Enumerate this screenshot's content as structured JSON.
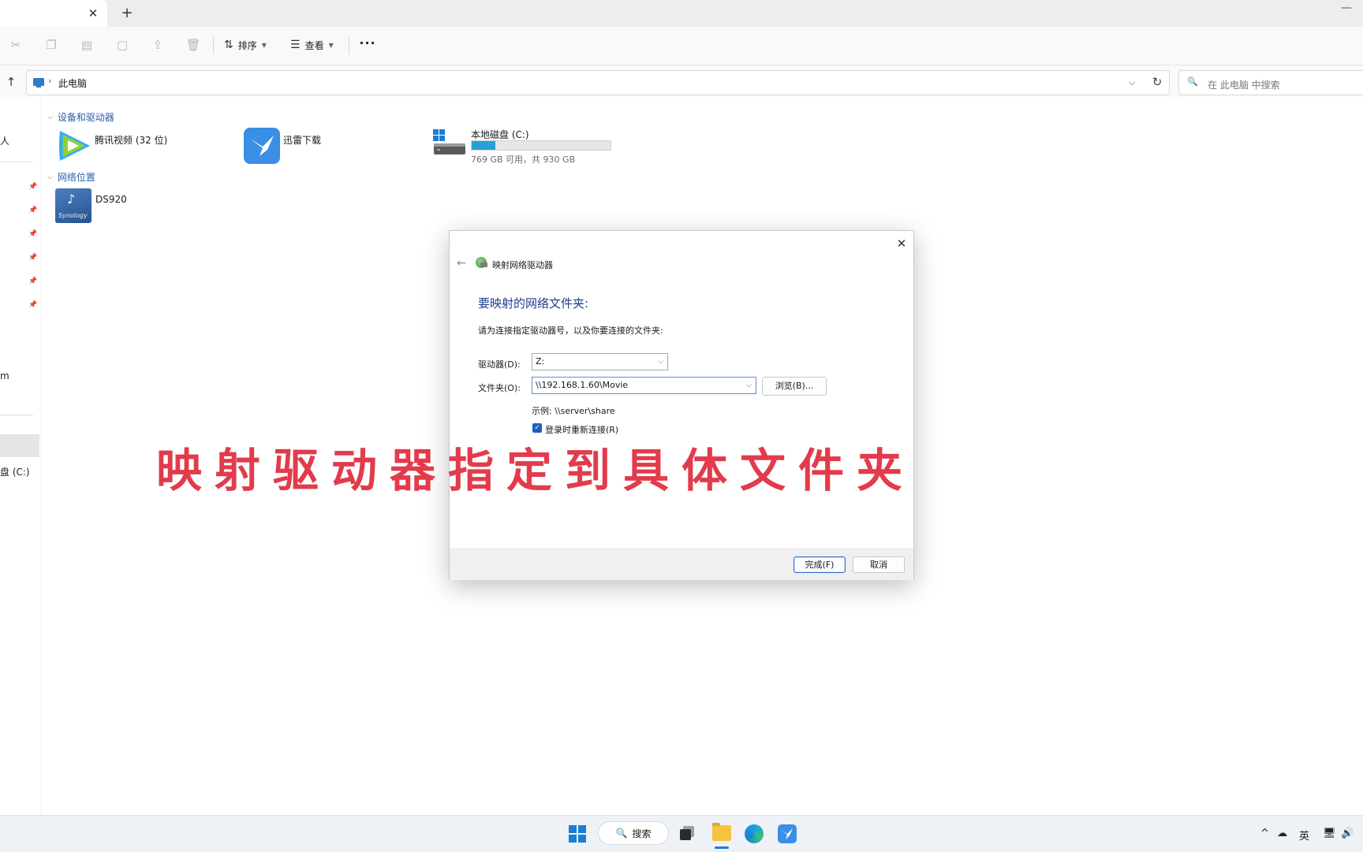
{
  "tabs": {
    "close_glyph": "✕",
    "new_glyph": "+"
  },
  "window": {
    "minimize_glyph": "—"
  },
  "toolbar": {
    "sort_label": "排序",
    "view_label": "查看",
    "more_glyph": "···"
  },
  "address": {
    "crumb": "此电脑",
    "search_placeholder": "在 此电脑 中搜索"
  },
  "nav": {
    "item_person_fragment": "人",
    "item_m_fragment": "m",
    "item_c_fragment": "盘 (C:)"
  },
  "content": {
    "group_devices": "设备和驱动器",
    "group_network": "网络位置",
    "items": {
      "tencent_video": "腾讯视频 (32 位)",
      "xunlei": "迅雷下载",
      "local_disk": "本地磁盘 (C:)",
      "local_disk_caption": "769 GB 可用，共 930 GB",
      "local_disk_used_fraction": 0.173,
      "ds920": "DS920",
      "synology_logo_text": "Synology"
    }
  },
  "dialog": {
    "title": "映射网络驱动器",
    "heading": "要映射的网络文件夹:",
    "description": "请为连接指定驱动器号，以及你要连接的文件夹:",
    "drive_label": "驱动器(D):",
    "drive_value": "Z:",
    "folder_label": "文件夹(O):",
    "folder_value": "\\\\192.168.1.60\\Movie",
    "browse_label": "浏览(B)...",
    "example": "示例: \\\\server\\share",
    "reconnect_label": "登录时重新连接(R)",
    "reconnect_checked": true,
    "finish_label": "完成(F)",
    "cancel_label": "取消"
  },
  "overlay": {
    "caption": "映射驱动器指定到具体文件夹"
  },
  "taskbar": {
    "search_label": "搜索",
    "tray_ime": "英"
  },
  "colors": {
    "accent": "#1a7fd4",
    "overlay_text": "#e23b4b",
    "dialog_heading": "#1d3f8a",
    "disk_fill": "#26a0da"
  }
}
